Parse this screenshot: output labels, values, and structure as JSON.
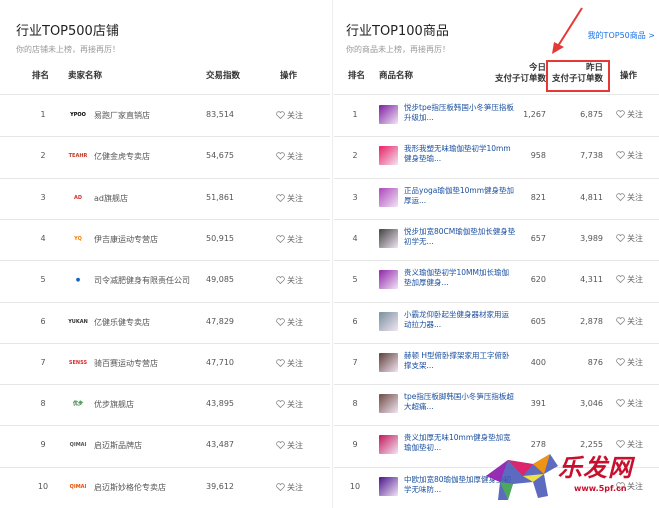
{
  "left": {
    "title": "行业TOP500店铺",
    "subtitle": "你的店铺未上榜，再接再厉！",
    "headers": {
      "rank": "排名",
      "name": "卖家名称",
      "index": "交易指数",
      "op": "操作"
    },
    "rows": [
      {
        "rank": "1",
        "logo": "YPOO",
        "logo_color": "#000000",
        "name": "易跑厂家直销店",
        "index": "83,514",
        "follow": "关注"
      },
      {
        "rank": "2",
        "logo": "TEAHR",
        "logo_color": "#c0392b",
        "name": "亿健金虎专卖店",
        "index": "54,675",
        "follow": "关注"
      },
      {
        "rank": "3",
        "logo": "AD",
        "logo_color": "#d32f2f",
        "name": "ad旗舰店",
        "index": "51,861",
        "follow": "关注"
      },
      {
        "rank": "4",
        "logo": "YQ",
        "logo_color": "#f57c00",
        "name": "伊吉康运动专营店",
        "index": "50,915",
        "follow": "关注"
      },
      {
        "rank": "5",
        "logo": "●",
        "logo_color": "#1565c0",
        "name": "司令减肥健身有限责任公司",
        "index": "49,085",
        "follow": "关注"
      },
      {
        "rank": "6",
        "logo": "YUKAN",
        "logo_color": "#333333",
        "name": "亿健乐健专卖店",
        "index": "47,829",
        "follow": "关注"
      },
      {
        "rank": "7",
        "logo": "SENSS",
        "logo_color": "#d32f2f",
        "name": "骑百赛运动专营店",
        "index": "47,710",
        "follow": "关注"
      },
      {
        "rank": "8",
        "logo": "优步",
        "logo_color": "#2e7d32",
        "name": "优步旗舰店",
        "index": "43,895",
        "follow": "关注"
      },
      {
        "rank": "9",
        "logo": "QIMAI",
        "logo_color": "#555555",
        "name": "启迈斯品牌店",
        "index": "43,487",
        "follow": "关注"
      },
      {
        "rank": "10",
        "logo": "QIMAI",
        "logo_color": "#e65100",
        "name": "启迈斯妙格伦专卖店",
        "index": "39,612",
        "follow": "关注"
      }
    ]
  },
  "right": {
    "title": "行业TOP100商品",
    "subtitle": "你的商品未上榜，再接再厉！",
    "more_link": "我的TOP50商品 >",
    "headers": {
      "rank": "排名",
      "name": "商品名称",
      "today_l1": "今日",
      "today_l2": "支付子订单数",
      "yest_l1": "昨日",
      "yest_l2": "支付子订单数",
      "op": "操作"
    },
    "rows": [
      {
        "rank": "1",
        "thumb": "#7b1fa2",
        "name": "悦步tpe指压板韩国小冬笋压指板升级加...",
        "today": "1,267",
        "yest": "6,875",
        "follow": "关注"
      },
      {
        "rank": "2",
        "thumb": "#e91e63",
        "name": "我形我塑无味瑜伽垫初学10mm健身垫瑜...",
        "today": "958",
        "yest": "7,738",
        "follow": "关注"
      },
      {
        "rank": "3",
        "thumb": "#ab47bc",
        "name": "正品yoga瑜伽垫10mm健身垫加厚运...",
        "today": "821",
        "yest": "4,811",
        "follow": "关注"
      },
      {
        "rank": "4",
        "thumb": "#424242",
        "name": "悦步加宽80CM瑜伽垫加长健身垫初学无...",
        "today": "657",
        "yest": "3,989",
        "follow": "关注"
      },
      {
        "rank": "5",
        "thumb": "#8e24aa",
        "name": "贵义瑜伽垫初学10MM加长瑜伽垫加厚健身...",
        "today": "620",
        "yest": "4,311",
        "follow": "关注"
      },
      {
        "rank": "6",
        "thumb": "#78909c",
        "name": "小霸龙仰卧起坐健身器材家用运动拉力器...",
        "today": "605",
        "year": "",
        "yest": "2,878",
        "follow": "关注"
      },
      {
        "rank": "7",
        "thumb": "#5d4037",
        "name": "赫顿 H型俯卧撑架家用工字俯卧撑支架...",
        "today": "400",
        "yest": "876",
        "follow": "关注"
      },
      {
        "rank": "8",
        "thumb": "#6d4c41",
        "name": "tpe指压板脚韩国小冬笋压指板超大超痛...",
        "today": "391",
        "yest": "3,046",
        "follow": "关注"
      },
      {
        "rank": "9",
        "thumb": "#c2185b",
        "name": "贵义加厚无味10mm健身垫加宽瑜伽垫初...",
        "today": "278",
        "yest": "2,255",
        "follow": "关注"
      },
      {
        "rank": "10",
        "thumb": "#4a148c",
        "name": "中欧加宽80瑜伽垫加厚健身垫初学无味防...",
        "today": "",
        "yest": "",
        "follow": "关注"
      }
    ]
  },
  "watermark": {
    "text": "乐发网",
    "url": "www.5pf.cn"
  }
}
